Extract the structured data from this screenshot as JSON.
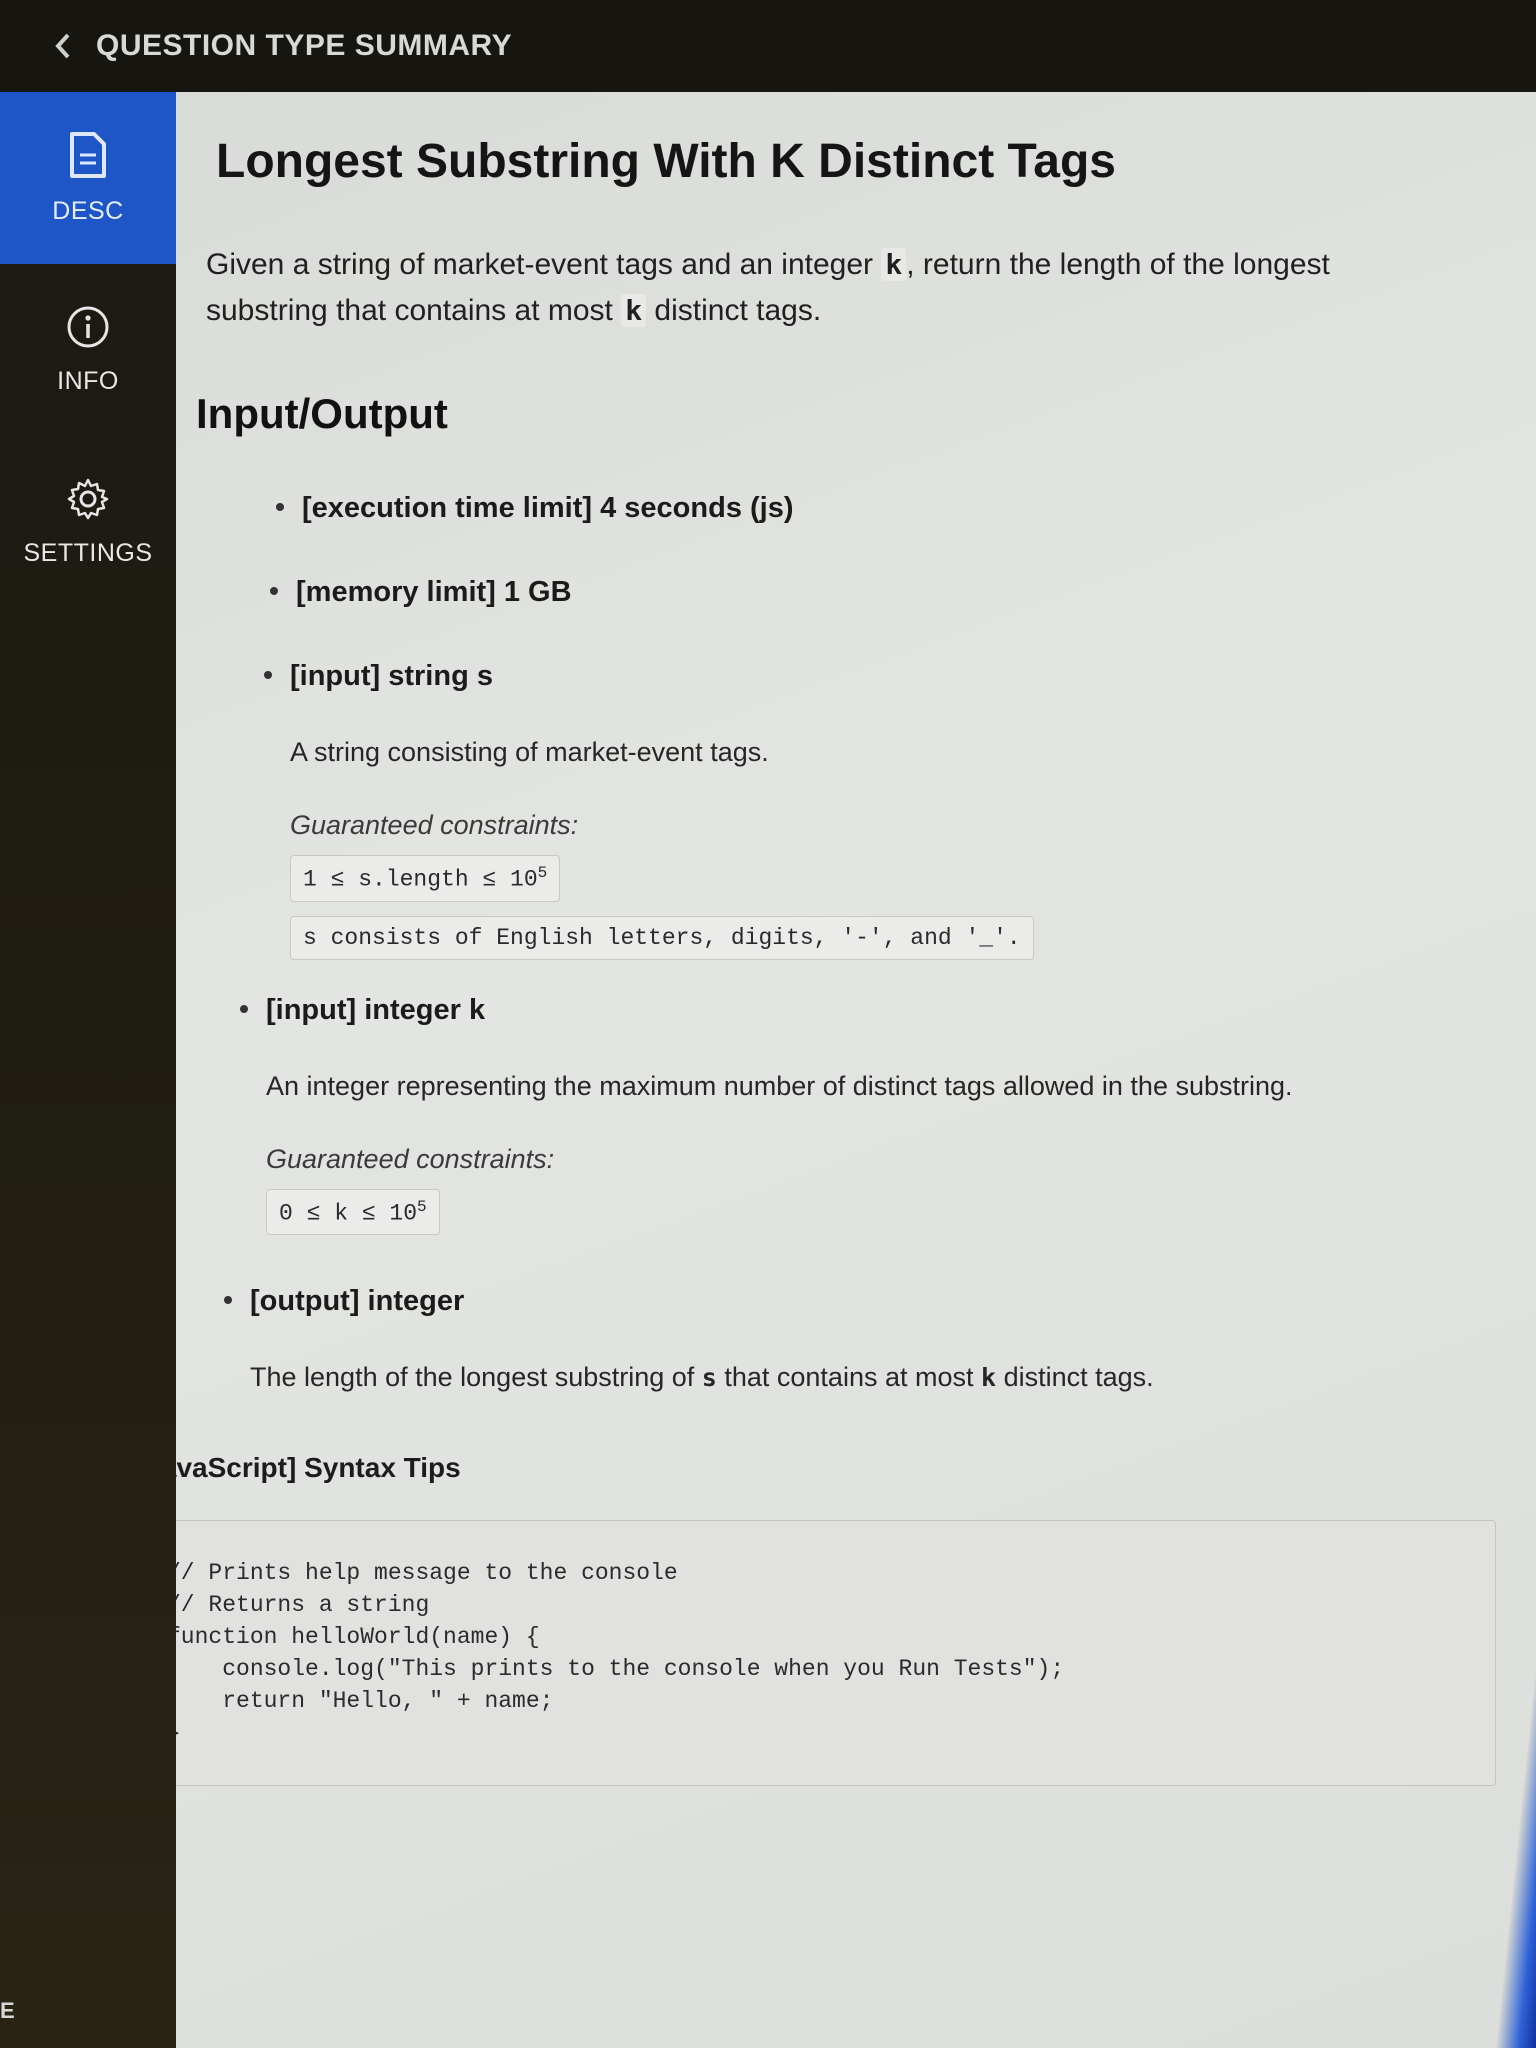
{
  "topbar": {
    "title": "QUESTION TYPE SUMMARY"
  },
  "sidebar": {
    "items": [
      {
        "label": "DESC",
        "icon": "document-icon",
        "active": true
      },
      {
        "label": "INFO",
        "icon": "info-icon",
        "active": false
      },
      {
        "label": "SETTINGS",
        "icon": "gear-icon",
        "active": false
      }
    ],
    "bottom_fragment": "E"
  },
  "problem": {
    "title": "Longest Substring With K Distinct Tags",
    "desc_part1": "Given a string of market-event tags and an integer ",
    "desc_k": "k",
    "desc_part2": ", return the length of the longest substring that contains at most ",
    "desc_part3": " distinct tags."
  },
  "io": {
    "section_title": "Input/Output",
    "items": [
      {
        "head": "[execution time limit] 4 seconds (js)"
      },
      {
        "head": "[memory limit] 1 GB"
      },
      {
        "head": "[input] string s",
        "body": "A string consisting of market-event tags.",
        "constraints_label": "Guaranteed constraints:",
        "constraints": [
          "1 ≤ s.length ≤ 10",
          "s consists of English letters, digits, '-', and '_'."
        ],
        "constraint_sup": "5"
      },
      {
        "head": "[input] integer k",
        "body": "An integer representing the maximum number of distinct tags allowed in the substring.",
        "constraints_label": "Guaranteed constraints:",
        "constraints": [
          "0 ≤ k ≤ 10"
        ],
        "constraint_sup": "5"
      },
      {
        "head": "[output] integer",
        "body_part1": "The length of the longest substring of ",
        "body_s": "s",
        "body_part2": " that contains at most ",
        "body_k": "k",
        "body_part3": " distinct tags."
      }
    ]
  },
  "tips": {
    "title": "[JavaScript] Syntax Tips",
    "code": "// Prints help message to the console\n// Returns a string\nfunction helloWorld(name) {\n    console.log(\"This prints to the console when you Run Tests\");\n    return \"Hello, \" + name;\n}"
  }
}
